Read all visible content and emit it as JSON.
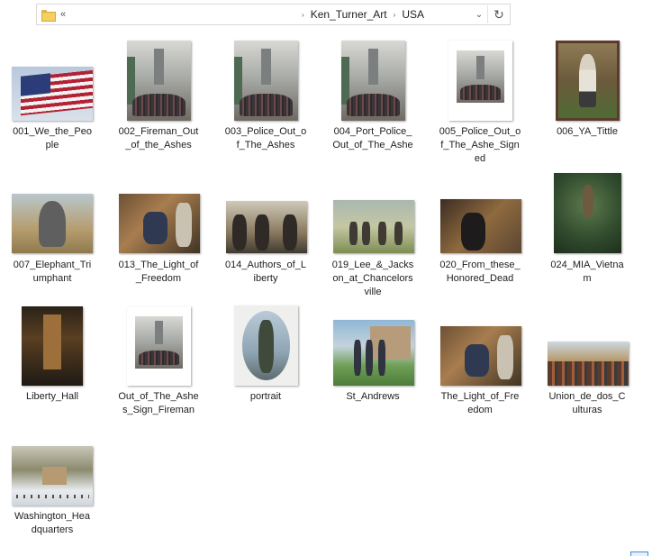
{
  "address_bar": {
    "overflow_chevron": "«",
    "breadcrumbs": [
      "Ken_Turner_Art",
      "USA"
    ],
    "separator_glyph": "›",
    "dropdown_glyph": "⌄",
    "refresh_glyph": "↻"
  },
  "files": [
    {
      "id": "f001",
      "label": "001_We_the_Peo\nple"
    },
    {
      "id": "f002",
      "label": "002_Fireman_Out\n_of_the_Ashes"
    },
    {
      "id": "f003",
      "label": "003_Police_Out_o\nf_The_Ashes"
    },
    {
      "id": "f004",
      "label": "004_Port_Police_\nOut_of_The_Ashe"
    },
    {
      "id": "f005",
      "label": "005_Police_Out_o\nf_The_Ashe_Sign\ned"
    },
    {
      "id": "f006",
      "label": "006_YA_Tittle"
    },
    {
      "id": "f007",
      "label": "007_Elephant_Tri\numphant"
    },
    {
      "id": "f013",
      "label": "013_The_Light_of\n_Freedom"
    },
    {
      "id": "f014",
      "label": "014_Authors_of_L\niberty"
    },
    {
      "id": "f019",
      "label": "019_Lee_&_Jacks\non_at_Chancelors\nville"
    },
    {
      "id": "f020",
      "label": "020_From_these_\nHonored_Dead"
    },
    {
      "id": "f024",
      "label": "024_MIA_Vietna\nm"
    },
    {
      "id": "liberty",
      "label": "Liberty_Hall"
    },
    {
      "id": "ootas",
      "label": "Out_of_The_Ashe\ns_Sign_Fireman"
    },
    {
      "id": "portrait",
      "label": "portrait"
    },
    {
      "id": "standrews",
      "label": "St_Andrews"
    },
    {
      "id": "lightfree",
      "label": "The_Light_of_Fre\nedom"
    },
    {
      "id": "union",
      "label": "Union_de_dos_C\nulturas"
    },
    {
      "id": "washington",
      "label": "Washington_Hea\ndquarters"
    }
  ]
}
